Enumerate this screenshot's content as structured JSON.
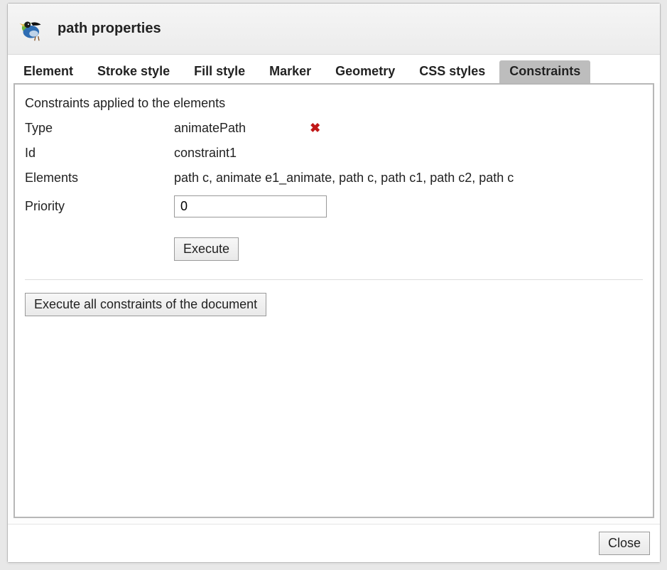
{
  "dialog": {
    "title": "path properties",
    "close_label": "Close"
  },
  "tabs": {
    "element": "Element",
    "stroke_style": "Stroke style",
    "fill_style": "Fill style",
    "marker": "Marker",
    "geometry": "Geometry",
    "css_styles": "CSS styles",
    "constraints": "Constraints"
  },
  "constraints_panel": {
    "heading": "Constraints applied to the elements",
    "labels": {
      "type": "Type",
      "id": "Id",
      "elements": "Elements",
      "priority": "Priority"
    },
    "values": {
      "type": "animatePath",
      "id": "constraint1",
      "elements": "path c, animate e1_animate, path c, path c1, path c2, path c",
      "priority": "0"
    },
    "execute_label": "Execute",
    "execute_all_label": "Execute all constraints of the document",
    "delete_icon_glyph": "✖"
  }
}
